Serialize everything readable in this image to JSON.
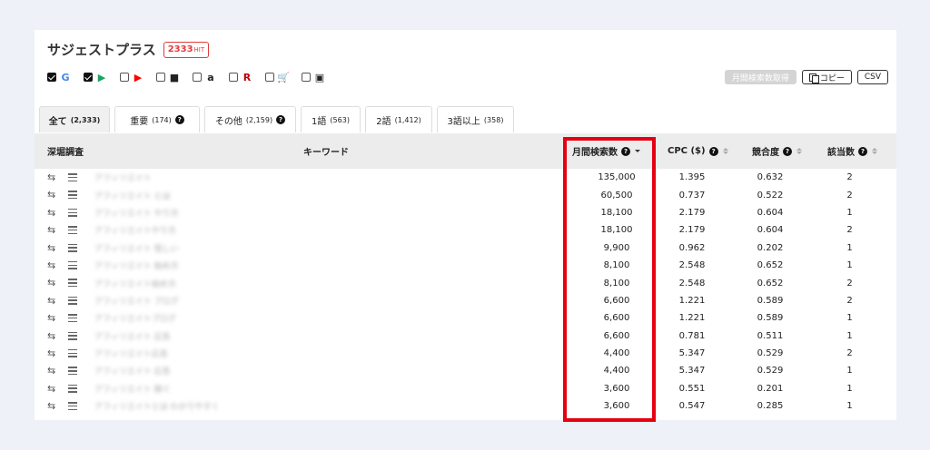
{
  "header": {
    "title": "サジェストプラス",
    "hit_count": "2333",
    "hit_suffix": "HIT"
  },
  "sources": [
    {
      "checked": true,
      "icon": "google-icon",
      "glyph": "G",
      "color": "#4285f4"
    },
    {
      "checked": true,
      "icon": "google-play-icon",
      "glyph": "▶",
      "color": "#1aa260"
    },
    {
      "checked": false,
      "icon": "youtube-icon",
      "glyph": "▶",
      "color": "#ff0000"
    },
    {
      "checked": false,
      "icon": "video-icon",
      "glyph": "■",
      "color": "#222222"
    },
    {
      "checked": false,
      "icon": "amazon-icon",
      "glyph": "a",
      "color": "#222222"
    },
    {
      "checked": false,
      "icon": "rakuten-icon",
      "glyph": "R",
      "color": "#bf0000"
    },
    {
      "checked": false,
      "icon": "shopping-cart-icon",
      "glyph": "🛒",
      "color": "#222222"
    },
    {
      "checked": false,
      "icon": "image-icon",
      "glyph": "▣",
      "color": "#222222"
    }
  ],
  "actions": {
    "fetch_label": "月間検索数取得",
    "copy_label": "コピー",
    "csv_label": "CSV"
  },
  "tabs": [
    {
      "label": "全て",
      "count": "(2,333)",
      "help": false
    },
    {
      "label": "重要",
      "count": "(174)",
      "help": true
    },
    {
      "label": "その他",
      "count": "(2,159)",
      "help": true
    },
    {
      "label": "1語",
      "count": "(563)",
      "help": false
    },
    {
      "label": "2語",
      "count": "(1,412)",
      "help": false
    },
    {
      "label": "3語以上",
      "count": "(358)",
      "help": false
    }
  ],
  "columns": {
    "deep": "深堀調査",
    "keyword": "キーワード",
    "volume": "月間検索数",
    "cpc": "CPC ($)",
    "competition": "競合度",
    "matches": "該当数"
  },
  "rows": [
    {
      "keyword": "アフィリエイト",
      "volume": "135,000",
      "cpc": "1.395",
      "competition": "0.632",
      "matches": "2"
    },
    {
      "keyword": "アフィリエイト とは",
      "volume": "60,500",
      "cpc": "0.737",
      "competition": "0.522",
      "matches": "2"
    },
    {
      "keyword": "アフィリエイト やり方",
      "volume": "18,100",
      "cpc": "2.179",
      "competition": "0.604",
      "matches": "1"
    },
    {
      "keyword": "アフィリエイトやり方",
      "volume": "18,100",
      "cpc": "2.179",
      "competition": "0.604",
      "matches": "2"
    },
    {
      "keyword": "アフィリエイト 怪しい",
      "volume": "9,900",
      "cpc": "0.962",
      "competition": "0.202",
      "matches": "1"
    },
    {
      "keyword": "アフィリエイト 始め方",
      "volume": "8,100",
      "cpc": "2.548",
      "competition": "0.652",
      "matches": "1"
    },
    {
      "keyword": "アフィリエイト始め方",
      "volume": "8,100",
      "cpc": "2.548",
      "competition": "0.652",
      "matches": "2"
    },
    {
      "keyword": "アフィリエイト ブログ",
      "volume": "6,600",
      "cpc": "1.221",
      "competition": "0.589",
      "matches": "2"
    },
    {
      "keyword": "アフィリエイトブログ",
      "volume": "6,600",
      "cpc": "1.221",
      "competition": "0.589",
      "matches": "1"
    },
    {
      "keyword": "アフィリエイト 広告",
      "volume": "6,600",
      "cpc": "0.781",
      "competition": "0.511",
      "matches": "1"
    },
    {
      "keyword": "アフィリエイト広告",
      "volume": "4,400",
      "cpc": "5.347",
      "competition": "0.529",
      "matches": "2"
    },
    {
      "keyword": "アフィリエイト 広告",
      "volume": "4,400",
      "cpc": "5.347",
      "competition": "0.529",
      "matches": "1"
    },
    {
      "keyword": "アフィリエイト 稼ぐ",
      "volume": "3,600",
      "cpc": "0.551",
      "competition": "0.201",
      "matches": "1"
    },
    {
      "keyword": "アフィリエイトとは わかりやすく",
      "volume": "3,600",
      "cpc": "0.547",
      "competition": "0.285",
      "matches": "1"
    }
  ],
  "colors": {
    "accent": "#e60012",
    "badge": "#e23b3b"
  }
}
